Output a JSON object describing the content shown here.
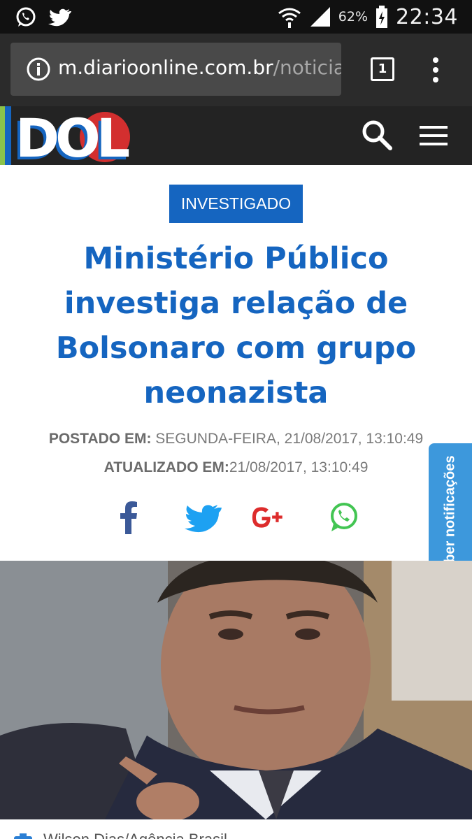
{
  "status_bar": {
    "time": "22:34",
    "battery_percent": "62%",
    "icons": [
      "whatsapp-icon",
      "twitter-icon",
      "wifi-icon",
      "signal-icon",
      "battery-icon"
    ]
  },
  "browser": {
    "url_host": "m.diarioonline.com.br",
    "url_path": "/noticia",
    "tab_count": "1"
  },
  "site": {
    "logo_text": "DOL",
    "colors": {
      "header_bg": "#232323",
      "accent": "#1565c0",
      "notify": "#3d98dc"
    }
  },
  "article": {
    "category": "INVESTIGADO",
    "headline": "Ministério Público investiga relação de Bolsonaro com grupo neonazista",
    "posted_label": "POSTADO EM:",
    "posted_value": "SEGUNDA-FEIRA, 21/08/2017, 13:10:49",
    "updated_label": "ATUALIZADO EM:",
    "updated_value": "21/08/2017, 13:10:49",
    "share": [
      "facebook-icon",
      "twitter-icon",
      "google-plus-icon",
      "whatsapp-icon"
    ],
    "caption": "Wilson Dias/Agência Brasil"
  },
  "notify": {
    "label": "Receber notificações"
  }
}
